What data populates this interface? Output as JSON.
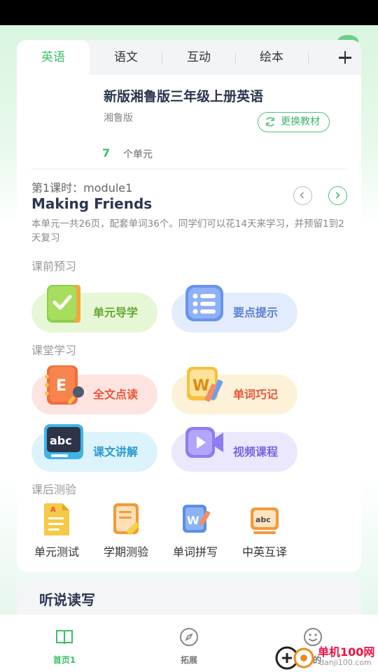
{
  "tabs": [
    {
      "label": "英语"
    },
    {
      "label": "语文"
    },
    {
      "label": "互动"
    },
    {
      "label": "绘本"
    }
  ],
  "book": {
    "title": "新版湘鲁版三年级上册英语",
    "publisher": "湘鲁版",
    "switch_label": "更换教材",
    "unit_count": "7",
    "unit_label": "个单元"
  },
  "lesson": {
    "label": "第1课时：module1",
    "title": "Making Friends",
    "description": "本单元一共26页，配套单词36个。同学们可以花14天来学习，并预留1到2天复习"
  },
  "sections": {
    "preview": "课前预习",
    "classroom": "课堂学习",
    "after": "课后测验"
  },
  "features": {
    "unit_guide": "单元导学",
    "key_points": "要点提示",
    "full_reading": "全文点读",
    "word_memory": "单词巧记",
    "text_explain": "课文讲解",
    "video_course": "视频课程"
  },
  "tests": [
    {
      "label": "单元测试"
    },
    {
      "label": "学期测验"
    },
    {
      "label": "单词拼写"
    },
    {
      "label": "中英互译"
    }
  ],
  "section2": {
    "title": "听说读写"
  },
  "bottom_nav": [
    {
      "label": "首页1"
    },
    {
      "label": "拓展"
    },
    {
      "label": "我的"
    }
  ],
  "watermark": {
    "text": "单机100网",
    "url": "danji100.com"
  },
  "colors": {
    "accent": "#3bbf6a",
    "feature_green": "#e6f7d6",
    "feature_blue": "#e3ecfc",
    "feature_red": "#fde4e0",
    "feature_yellow": "#fdf2d8",
    "feature_cyan": "#dcf3fb",
    "feature_purple": "#ebe7fc"
  }
}
